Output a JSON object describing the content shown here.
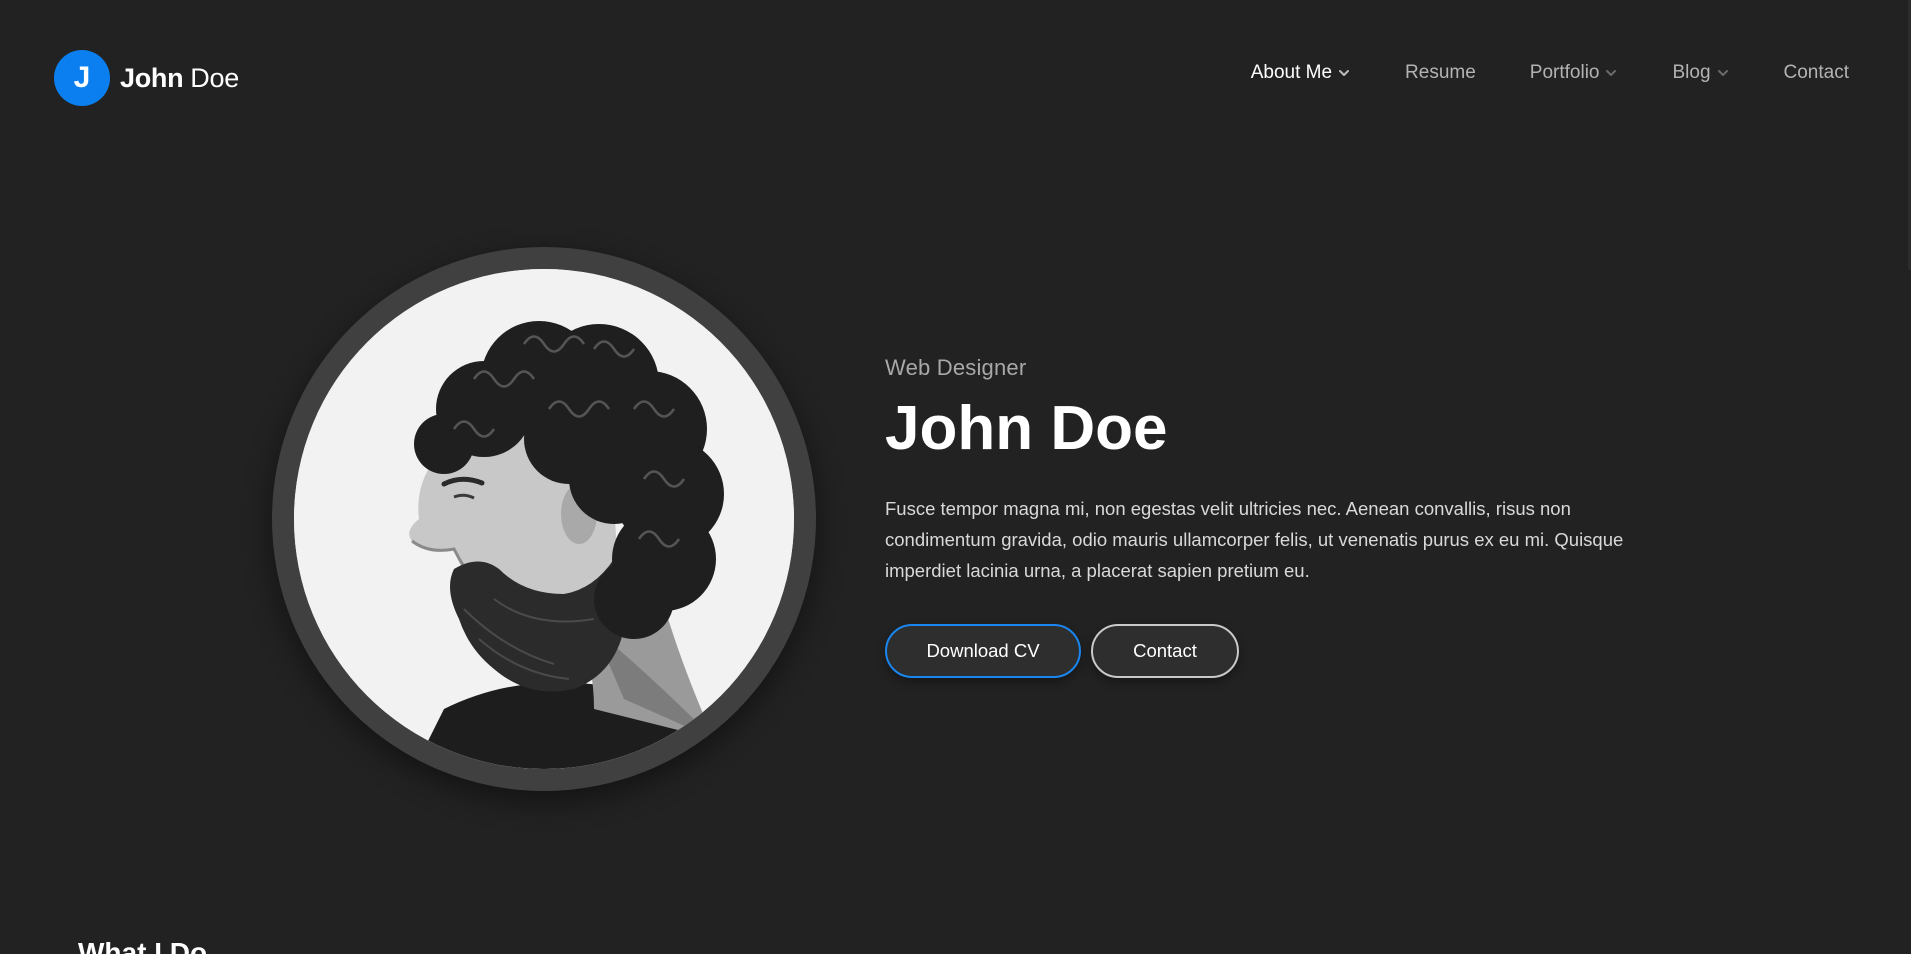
{
  "brand": {
    "initial": "J",
    "first_name": "John",
    "last_name": "Doe",
    "accent_color": "#0b7ff0"
  },
  "nav": {
    "items": [
      {
        "label": "About Me",
        "has_dropdown": true,
        "active": true
      },
      {
        "label": "Resume",
        "has_dropdown": false,
        "active": false
      },
      {
        "label": "Portfolio",
        "has_dropdown": true,
        "active": false
      },
      {
        "label": "Blog",
        "has_dropdown": true,
        "active": false
      },
      {
        "label": "Contact",
        "has_dropdown": false,
        "active": false
      }
    ]
  },
  "hero": {
    "subtitle": "Web Designer",
    "title": "John Doe",
    "description": "Fusce tempor magna mi, non egestas velit ultricies nec. Aenean convallis, risus non condimentum gravida, odio mauris ullamcorper felis, ut venenatis purus ex eu mi. Quisque imperdiet lacinia urna, a placerat sapien pretium eu.",
    "buttons": {
      "download_cv": "Download CV",
      "contact": "Contact"
    }
  },
  "next_section": {
    "heading": "What I Do"
  },
  "colors": {
    "background": "#222222",
    "primary_button_border": "#1a86f0",
    "secondary_button_border": "#c9c9c9",
    "avatar_ring": "#404040"
  }
}
